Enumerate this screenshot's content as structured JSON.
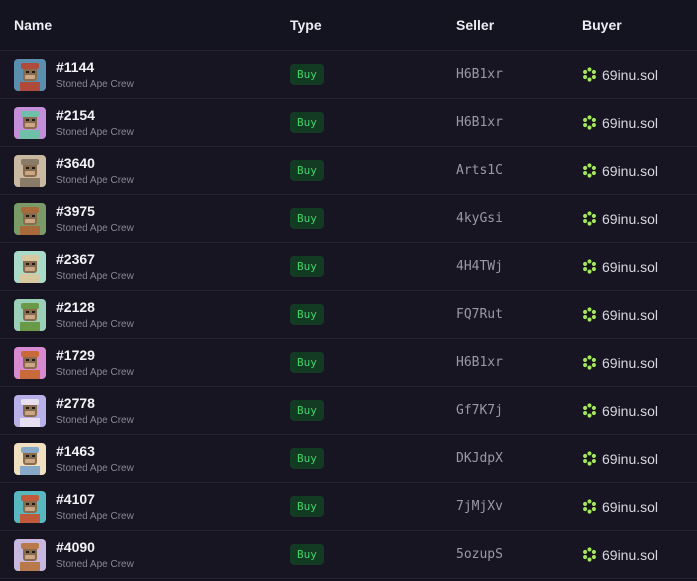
{
  "header": {
    "name": "Name",
    "type": "Type",
    "seller": "Seller",
    "buyer": "Buyer"
  },
  "colors": {
    "background": "#13121b",
    "badge_text": "#3fd46a",
    "badge_bg": "#133a22",
    "buyer_icon": "#a4e85a"
  },
  "rows": [
    {
      "id": "#1144",
      "collection": "Stoned Ape Crew",
      "type": "Buy",
      "seller": "H6B1xr",
      "buyer": "69inu.sol",
      "avatar_bg": "#5a8fb0",
      "avatar_fg": "#b04a3a"
    },
    {
      "id": "#2154",
      "collection": "Stoned Ape Crew",
      "type": "Buy",
      "seller": "H6B1xr",
      "buyer": "69inu.sol",
      "avatar_bg": "#c48fd8",
      "avatar_fg": "#6fc0a8"
    },
    {
      "id": "#3640",
      "collection": "Stoned Ape Crew",
      "type": "Buy",
      "seller": "Arts1C",
      "buyer": "69inu.sol",
      "avatar_bg": "#c9b9a0",
      "avatar_fg": "#8a7a68"
    },
    {
      "id": "#3975",
      "collection": "Stoned Ape Crew",
      "type": "Buy",
      "seller": "4kyGsi",
      "buyer": "69inu.sol",
      "avatar_bg": "#7a9b68",
      "avatar_fg": "#a86a3a"
    },
    {
      "id": "#2367",
      "collection": "Stoned Ape Crew",
      "type": "Buy",
      "seller": "4H4TWj",
      "buyer": "69inu.sol",
      "avatar_bg": "#a8dcc8",
      "avatar_fg": "#d8c8a0"
    },
    {
      "id": "#2128",
      "collection": "Stoned Ape Crew",
      "type": "Buy",
      "seller": "FQ7Rut",
      "buyer": "69inu.sol",
      "avatar_bg": "#9ad0b8",
      "avatar_fg": "#6a9a48"
    },
    {
      "id": "#1729",
      "collection": "Stoned Ape Crew",
      "type": "Buy",
      "seller": "H6B1xr",
      "buyer": "69inu.sol",
      "avatar_bg": "#d88ad0",
      "avatar_fg": "#c86a3a"
    },
    {
      "id": "#2778",
      "collection": "Stoned Ape Crew",
      "type": "Buy",
      "seller": "Gf7K7j",
      "buyer": "69inu.sol",
      "avatar_bg": "#b8b0e8",
      "avatar_fg": "#e8e0f0"
    },
    {
      "id": "#1463",
      "collection": "Stoned Ape Crew",
      "type": "Buy",
      "seller": "DKJdpX",
      "buyer": "69inu.sol",
      "avatar_bg": "#f0e0c0",
      "avatar_fg": "#88a8c8"
    },
    {
      "id": "#4107",
      "collection": "Stoned Ape Crew",
      "type": "Buy",
      "seller": "7jMjXv",
      "buyer": "69inu.sol",
      "avatar_bg": "#58b8c0",
      "avatar_fg": "#c05a3a"
    },
    {
      "id": "#4090",
      "collection": "Stoned Ape Crew",
      "type": "Buy",
      "seller": "5ozupS",
      "buyer": "69inu.sol",
      "avatar_bg": "#c8b8e0",
      "avatar_fg": "#b87a4a"
    }
  ]
}
